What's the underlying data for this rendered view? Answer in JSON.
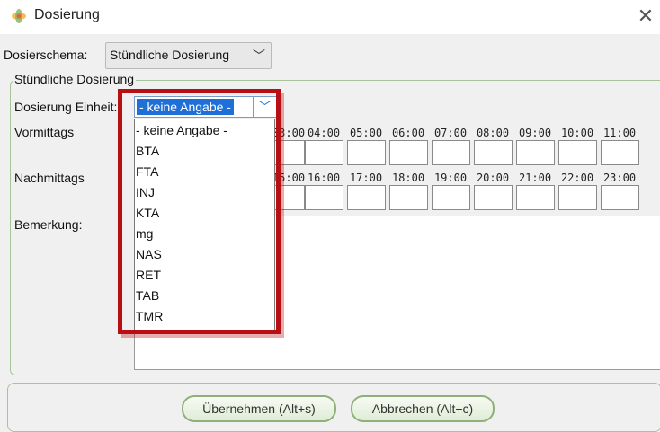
{
  "window": {
    "title": "Dosierung",
    "close_glyph": "✕"
  },
  "schema": {
    "label": "Dosierschema:",
    "value": "Stündliche Dosierung"
  },
  "group": {
    "legend": "Stündliche Dosierung"
  },
  "unit": {
    "label": "Dosierung Einheit:",
    "selected": "- keine Angabe -"
  },
  "dropdown_options": [
    "- keine Angabe -",
    "BTA",
    "FTA",
    "INJ",
    "KTA",
    "mg",
    "NAS",
    "RET",
    "TAB",
    "TMR"
  ],
  "morning": {
    "label": "Vormittags",
    "hours": [
      "03:00",
      "04:00",
      "05:00",
      "06:00",
      "07:00",
      "08:00",
      "09:00",
      "10:00",
      "11:00"
    ]
  },
  "afternoon": {
    "label": "Nachmittags",
    "hours": [
      "15:00",
      "16:00",
      "17:00",
      "18:00",
      "19:00",
      "20:00",
      "21:00",
      "22:00",
      "23:00"
    ]
  },
  "remark": {
    "label": "Bemerkung:",
    "value": ""
  },
  "buttons": {
    "apply": "Übernehmen (Alt+s)",
    "cancel": "Abbrechen (Alt+c)"
  },
  "colors": {
    "accent": "#1f6fd8",
    "highlight": "#b70f14",
    "group_border": "#a8c39a"
  }
}
